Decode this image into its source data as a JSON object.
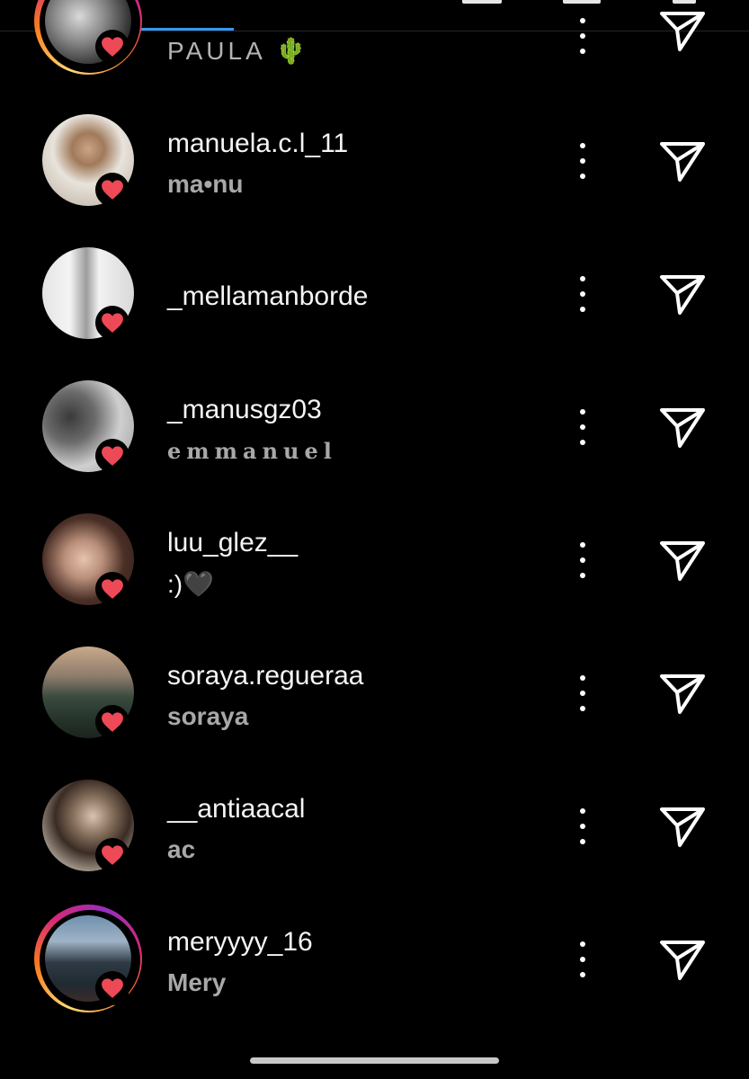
{
  "rows": [
    {
      "username": "",
      "subname": "PAULA 🌵",
      "story_ring": true
    },
    {
      "username": "manuela.c.l_11",
      "subname": "ma•nu",
      "story_ring": false
    },
    {
      "username": "_mellamanborde",
      "subname": "",
      "story_ring": false
    },
    {
      "username": "_manusgz03",
      "subname": "emmanuel",
      "story_ring": false
    },
    {
      "username": "luu_glez__",
      "subname": ":)🖤",
      "story_ring": false
    },
    {
      "username": "soraya.regueraa",
      "subname": "soraya",
      "story_ring": false
    },
    {
      "username": "__antiaacal",
      "subname": "ac",
      "story_ring": false
    },
    {
      "username": "meryyyy_16",
      "subname": "Mery",
      "story_ring": true
    }
  ],
  "icons": {
    "like_badge": "heart-icon",
    "options": "more-options-icon",
    "send": "paper-plane-icon"
  },
  "colors": {
    "background": "#000000",
    "heart": "#ed4956",
    "tab_indicator": "#3897f0",
    "subtext": "#a8a8a8"
  }
}
